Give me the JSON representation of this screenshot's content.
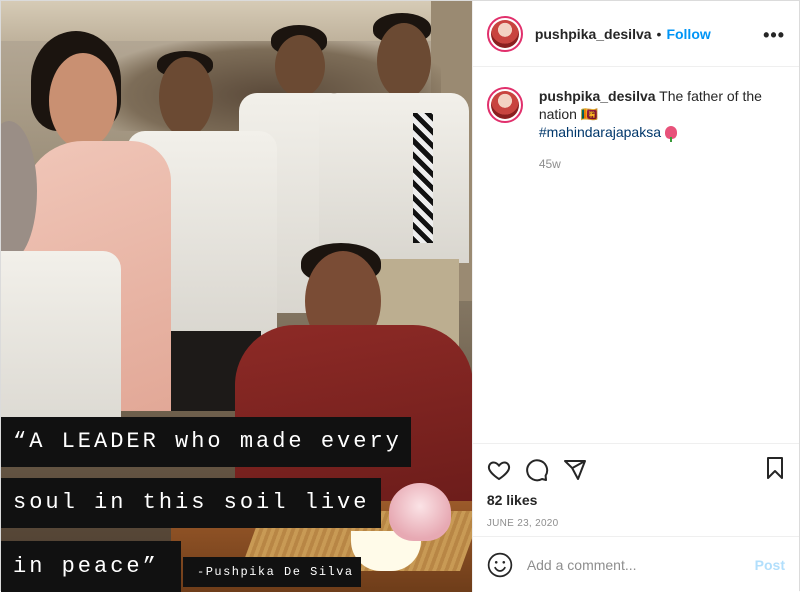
{
  "photo": {
    "quote_lines": [
      "“A LEADER who made every",
      "soul in this soil live",
      "in peace”"
    ],
    "signature": "-Pushpika De Silva"
  },
  "header": {
    "username": "pushpika_desilva",
    "separator": "•",
    "follow_label": "Follow",
    "more_icon": "more-options-icon",
    "more_glyph": "•••"
  },
  "caption": {
    "username": "pushpika_desilva",
    "text": "The father of the nation 🇱🇰",
    "hashtag": "#mahindarajapaksa",
    "time_ago": "45w"
  },
  "actions": {
    "icons": [
      "heart-icon",
      "comment-icon",
      "share-icon",
      "bookmark-icon"
    ],
    "likes": "82 likes",
    "date": "JUNE 23, 2020"
  },
  "comment": {
    "placeholder": "Add a comment...",
    "post_label": "Post"
  },
  "colors": {
    "follow_blue": "#0095f6",
    "post_disabled": "#b2dffc",
    "hashtag": "#00376b",
    "text_primary": "#262626",
    "text_secondary": "#8e8e8e"
  }
}
